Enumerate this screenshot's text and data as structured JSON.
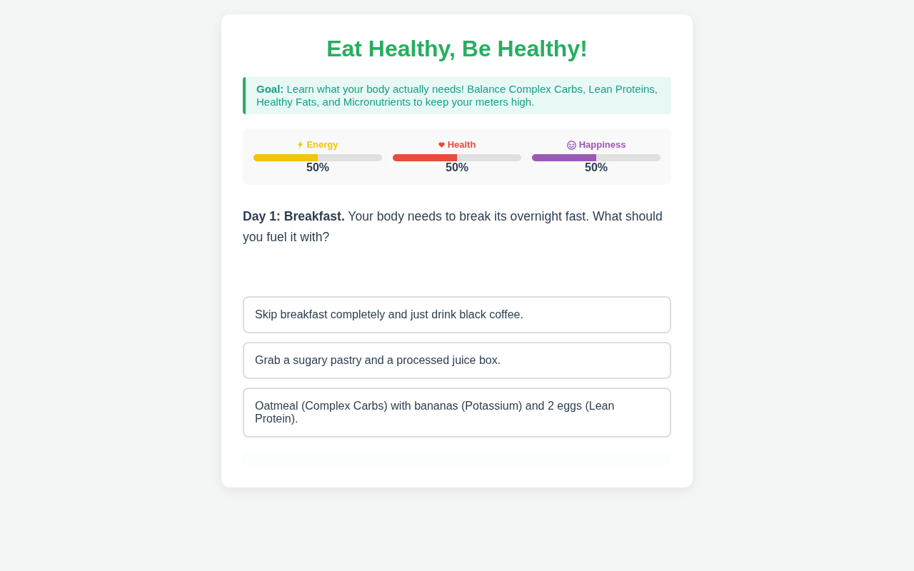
{
  "title": "Eat Healthy, Be Healthy!",
  "goal": "**Goal:** Learn what your body actually needs! Balance Complex Carbs, Lean Proteins, Healthy Fats, and Micronutrients to keep your meters high.",
  "meters": [
    {
      "label": "Energy",
      "color": "#f1c40f",
      "level": 0.5,
      "reading": "50%"
    },
    {
      "label": "Health",
      "color": "#e74c3c",
      "level": 0.5,
      "reading": "50%"
    },
    {
      "label": "Happiness",
      "color": "#9b59b6",
      "level": 0.5,
      "reading": "50%"
    }
  ],
  "story": "**Day 1: Breakfast.** Your body needs to break its overnight fast. What should you fuel it with?",
  "choices": [
    "Skip breakfast completely and just drink black coffee.",
    "Grab a sugary pastry and a processed juice box.",
    "Oatmeal (Complex Carbs) with bananas (Potassium) and 2 eggs (Lean Protein)."
  ]
}
